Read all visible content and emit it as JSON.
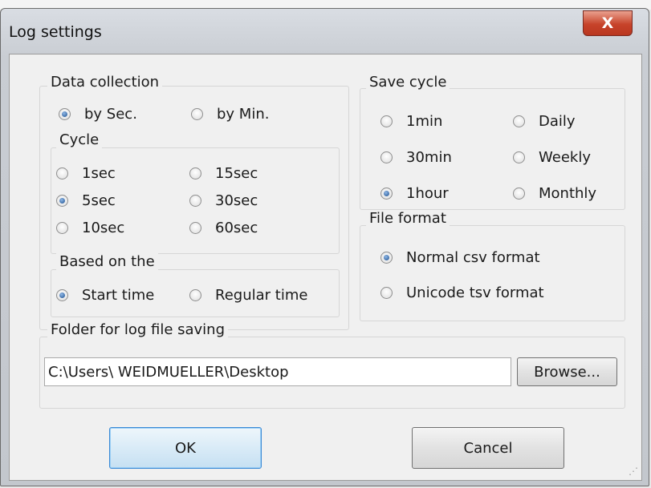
{
  "window": {
    "title": "Log settings",
    "close_glyph": "X"
  },
  "data_collection": {
    "label": "Data collection",
    "by_sec": "by Sec.",
    "by_min": "by Min.",
    "selected": "by_sec"
  },
  "cycle": {
    "label": "Cycle",
    "options": [
      "1sec",
      "15sec",
      "5sec",
      "30sec",
      "10sec",
      "60sec"
    ],
    "selected": "5sec"
  },
  "based_on": {
    "label": "Based on the",
    "start_time": "Start time",
    "regular_time": "Regular time",
    "selected": "start_time"
  },
  "save_cycle": {
    "label": "Save cycle",
    "options": [
      "1min",
      "Daily",
      "30min",
      "Weekly",
      "1hour",
      "Monthly"
    ],
    "selected": "1hour"
  },
  "file_format": {
    "label": "File format",
    "normal_csv": "Normal csv format",
    "unicode_tsv": "Unicode tsv format",
    "selected": "normal_csv"
  },
  "folder": {
    "label": "Folder for log file saving",
    "path": "C:\\Users\\ WEIDMUELLER\\Desktop",
    "browse_label": "Browse..."
  },
  "buttons": {
    "ok": "OK",
    "cancel": "Cancel"
  },
  "icons": {
    "radio": "radio-button-icon",
    "close": "close-icon",
    "resize": "resize-grip-icon"
  }
}
